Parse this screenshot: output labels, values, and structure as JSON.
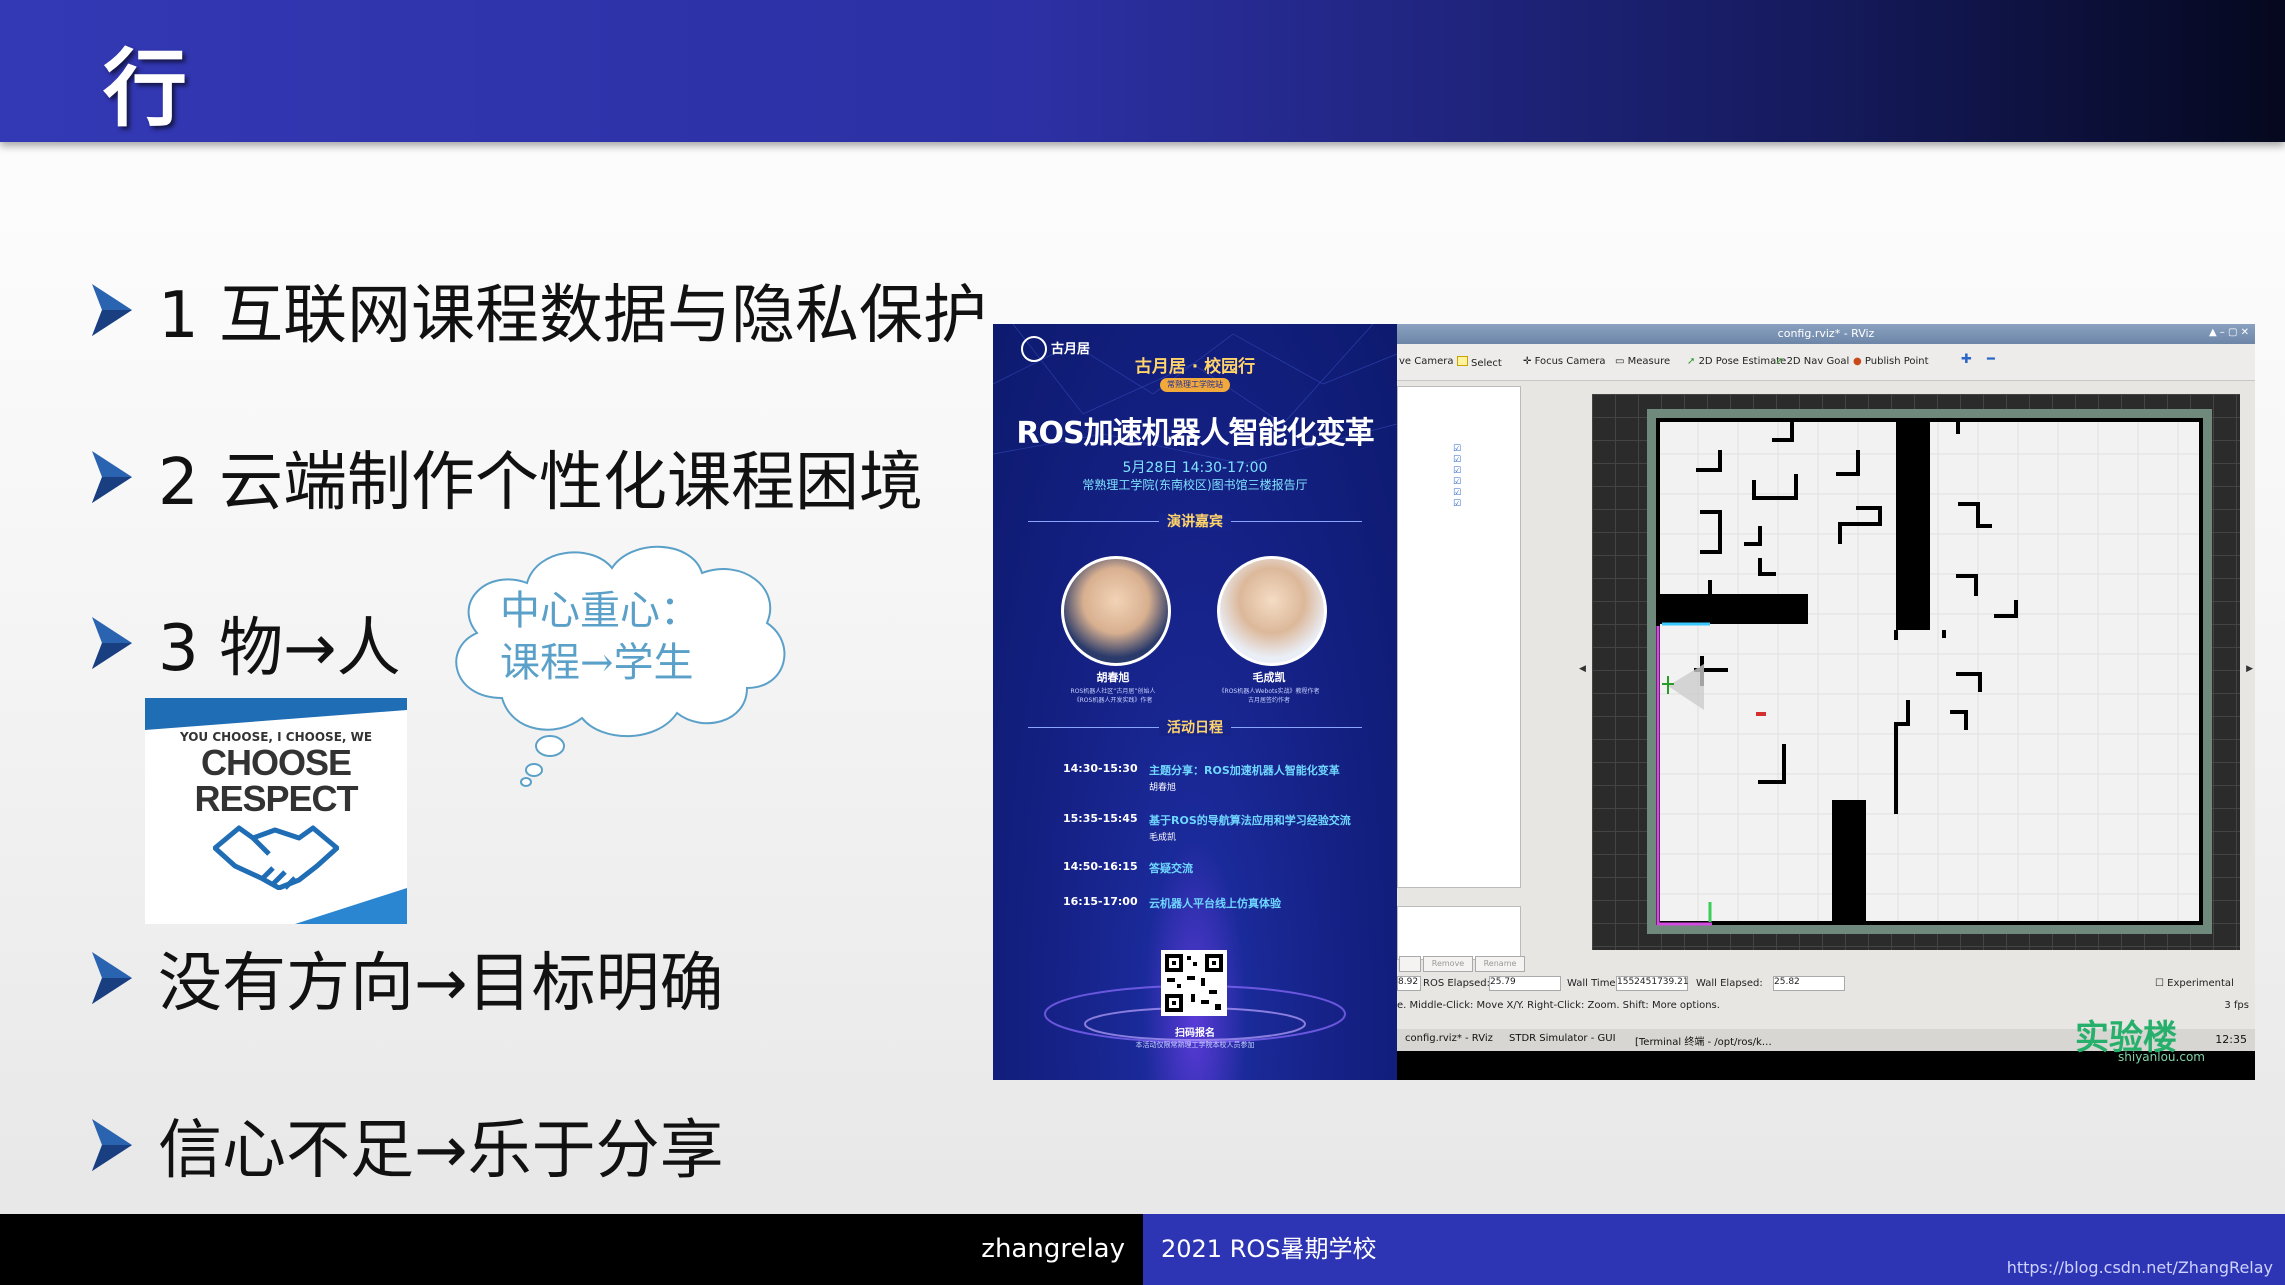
{
  "header": {
    "title": "行"
  },
  "bullets": [
    {
      "text": "1 互联网课程数据与隐私保护"
    },
    {
      "text": "2 云端制作个性化课程困境"
    },
    {
      "text": "3 物→人"
    },
    {
      "text": "没有方向→目标明确"
    },
    {
      "text": "信心不足→乐于分享"
    }
  ],
  "cloud": {
    "line1": "中心重心：",
    "line2": "课程→学生"
  },
  "respect_image": {
    "small": "YOU CHOOSE, I CHOOSE, WE",
    "line1": "CHOOSE",
    "line2": "RESPECT"
  },
  "poster": {
    "brand": "古月居",
    "event": "古月居 · 校园行",
    "host": "常熟理工学院站",
    "title": "ROS加速机器人智能化变革",
    "date": "5月28日 14:30-17:00",
    "venue": "常熟理工学院(东南校区)图书馆三楼报告厅",
    "speakers_heading": "演讲嘉宾",
    "speaker1": {
      "name": "胡春旭",
      "desc1": "ROS机器人社区“古月居”创始人",
      "desc2": "《ROS机器人开发实践》作者"
    },
    "speaker2": {
      "name": "毛成凯",
      "desc1": "《ROS机器人Webots实战》教程作者",
      "desc2": "古月居签约作者"
    },
    "schedule_heading": "活动日程",
    "schedule": [
      {
        "time": "14:30-15:30",
        "item": "主题分享：ROS加速机器人智能化变革",
        "sub": "胡春旭"
      },
      {
        "time": "15:35-15:45",
        "item": "基于ROS的导航算法应用和学习经验交流",
        "sub": "毛成凯"
      },
      {
        "time": "14:50-16:15",
        "item": "答疑交流",
        "sub": ""
      },
      {
        "time": "16:15-17:00",
        "item": "云机器人平台线上仿真体验",
        "sub": ""
      }
    ],
    "signup": "扫码报名",
    "footnote": "本活动仅限常熟理工学院本校人员参加"
  },
  "rviz": {
    "window_title": "config.rviz* - RViz",
    "tools": [
      "ve Camera",
      "Select",
      "Focus Camera",
      "Measure",
      "2D Pose Estimate",
      "2D Nav Goal",
      "Publish Point"
    ],
    "panel_buttons": [
      "Remove",
      "Rename"
    ],
    "status": {
      "ros_time_partial": "8.92",
      "ros_elapsed_label": "ROS Elapsed:",
      "ros_elapsed": "25.79",
      "wall_time_label": "Wall Time:",
      "wall_time": "1552451739.21",
      "wall_elapsed_label": "Wall Elapsed:",
      "wall_elapsed": "25.82",
      "experimental": "Experimental"
    },
    "hint": "e. Middle-Click: Move X/Y. Right-Click: Zoom. Shift: More options.",
    "fps": "3 fps",
    "taskbar": [
      "config.rviz* - RViz",
      "STDR Simulator - GUI",
      "[Terminal 终端 - /opt/ros/k…"
    ],
    "clock": "12:35"
  },
  "watermark": {
    "main": "实验楼",
    "sub": "shiyanlou.com"
  },
  "footer": {
    "author": "zhangrelay",
    "course": "2021 ROS暑期学校",
    "url": "https://blog.csdn.net/ZhangRelay"
  },
  "colors": {
    "header": "#2c30a4",
    "footer_blue": "#2e35b5",
    "bullet_arrow": "#2a64b0",
    "cloud_text": "#5aa0c8"
  }
}
